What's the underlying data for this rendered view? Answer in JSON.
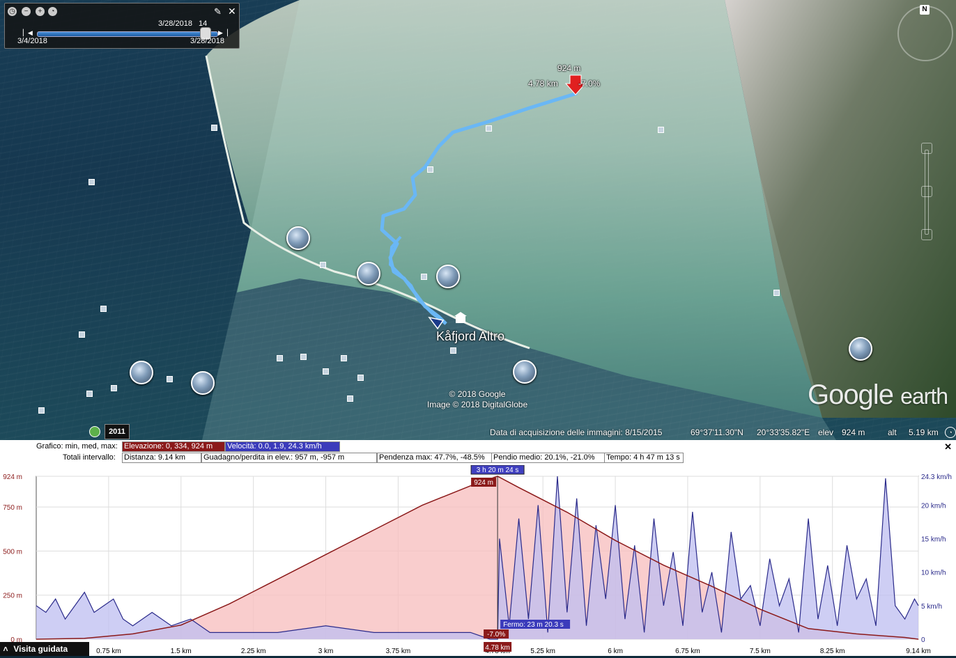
{
  "time_slider": {
    "current_date": "3/28/2018",
    "current_time": "14",
    "start_date": "3/4/2018",
    "end_date": "3/28/2018",
    "position": 0.95,
    "icons": [
      "clock-icon",
      "zoom-out-icon",
      "zoom-in-icon",
      "time-settings-icon",
      "wrench-icon",
      "close-icon"
    ]
  },
  "map": {
    "place_name": "Kåfjord Altro",
    "hover_elevation": "924 m",
    "hover_distance": "4.78 km",
    "hover_slope": "-7.0%",
    "copyright_line1": "© 2018 Google",
    "copyright_line2": "Image © 2018 DigitalGlobe",
    "brand_google": "Google",
    "brand_earth": "earth",
    "compass_letter": "N",
    "imagery_year": "2011",
    "track_color": "#6ab7f5"
  },
  "status_bar": {
    "imagery_date": "Data di acquisizione delle immagini: 8/15/2015",
    "lat": "69°37'11.30\"N",
    "lon": "20°33'35.82\"E",
    "elev_label": "elev",
    "elev_value": "924 m",
    "alt_label": "alt",
    "alt_value": "5.19 km"
  },
  "profile_panel": {
    "row1_label": "Grafico: min, med, max:",
    "elevation_stats": "Elevazione: 0, 334, 924 m",
    "speed_stats": "Velocità: 0.0, 1.9, 24.3 km/h",
    "row2_label": "Totali intervallo:",
    "distance": "Distanza: 9.14 km",
    "gain_loss": "Guadagno/perdita in elev.: 957 m, -957 m",
    "max_slope": "Pendenza max: 47.7%, -48.5%",
    "avg_slope": "Pendio medio: 20.1%, -21.0%",
    "time": "Tempo: 4 h 47 m 13 s",
    "close_label": "✕",
    "tour_button": "Visita guidata",
    "tour_icon": "chevron-up-icon"
  },
  "chart_data": {
    "type": "area",
    "x_unit": "km",
    "x_range": [
      0,
      9.14
    ],
    "elevation_ylim": [
      0,
      924
    ],
    "speed_ylim": [
      0,
      24.3
    ],
    "elevation_color": "#8b1a1a",
    "elevation_fill": "#f7c0c0",
    "speed_color": "#2a2a8a",
    "speed_fill": "#bdbdf0",
    "left_ticks": [
      "924 m",
      "750 m",
      "500 m",
      "250 m",
      "0 m"
    ],
    "left_tick_values": [
      924,
      750,
      500,
      250,
      0
    ],
    "right_ticks": [
      "24.3 km/h",
      "20 km/h",
      "15 km/h",
      "10 km/h",
      "5 km/h",
      "0"
    ],
    "right_tick_values": [
      24.3,
      20,
      15,
      10,
      5,
      0
    ],
    "x_ticks": [
      "0.75 km",
      "1.5 km",
      "2.25 km",
      "3 km",
      "3.75 km",
      "4.78 km",
      "5.25 km",
      "6 km",
      "6.75 km",
      "7.5 km",
      "8.25 km",
      "9.14 km"
    ],
    "x_tick_values": [
      0.75,
      1.5,
      2.25,
      3,
      3.75,
      4.78,
      5.25,
      6,
      6.75,
      7.5,
      8.25,
      9.14
    ],
    "cursor_x": 4.78,
    "cursor_time": "3 h 20 m 24 s",
    "cursor_elevation": "924 m",
    "cursor_slope": "-7.0%",
    "stop_label": "Fermo: 23 m 20.3 s",
    "elevation": {
      "x": [
        0,
        0.5,
        1.0,
        1.5,
        2.0,
        2.25,
        2.5,
        3.0,
        3.5,
        4.0,
        4.5,
        4.78,
        5.0,
        5.5,
        6.0,
        6.5,
        7.0,
        7.5,
        8.0,
        8.5,
        9.0,
        9.14
      ],
      "y": [
        0,
        5,
        30,
        80,
        200,
        270,
        340,
        480,
        620,
        760,
        870,
        924,
        860,
        720,
        560,
        420,
        300,
        170,
        60,
        30,
        10,
        0
      ]
    },
    "speed": {
      "x": [
        0,
        0.1,
        0.2,
        0.3,
        0.4,
        0.5,
        0.6,
        0.7,
        0.8,
        0.9,
        1.0,
        1.2,
        1.4,
        1.6,
        1.8,
        2.0,
        2.5,
        3.0,
        3.5,
        4.0,
        4.5,
        4.7,
        4.78,
        4.8,
        4.9,
        5.0,
        5.1,
        5.2,
        5.3,
        5.4,
        5.5,
        5.6,
        5.7,
        5.8,
        5.9,
        6.0,
        6.1,
        6.2,
        6.3,
        6.4,
        6.5,
        6.6,
        6.7,
        6.8,
        6.9,
        7.0,
        7.1,
        7.2,
        7.3,
        7.4,
        7.5,
        7.6,
        7.7,
        7.8,
        7.9,
        8.0,
        8.1,
        8.2,
        8.3,
        8.4,
        8.5,
        8.6,
        8.7,
        8.8,
        8.9,
        9.0,
        9.1,
        9.14
      ],
      "y": [
        5,
        4,
        6,
        3,
        5,
        7,
        4,
        5,
        6,
        3,
        2,
        4,
        2,
        3,
        1,
        1,
        1,
        2,
        1,
        1,
        1,
        0,
        0,
        15,
        2,
        18,
        3,
        20,
        1,
        24.3,
        4,
        21,
        2,
        17,
        6,
        20,
        3,
        14,
        1,
        18,
        5,
        13,
        2,
        19,
        4,
        10,
        1,
        16,
        6,
        8,
        2,
        12,
        5,
        9,
        1,
        18,
        3,
        11,
        2,
        14,
        6,
        9,
        2,
        24,
        5,
        3,
        6,
        5
      ]
    }
  }
}
